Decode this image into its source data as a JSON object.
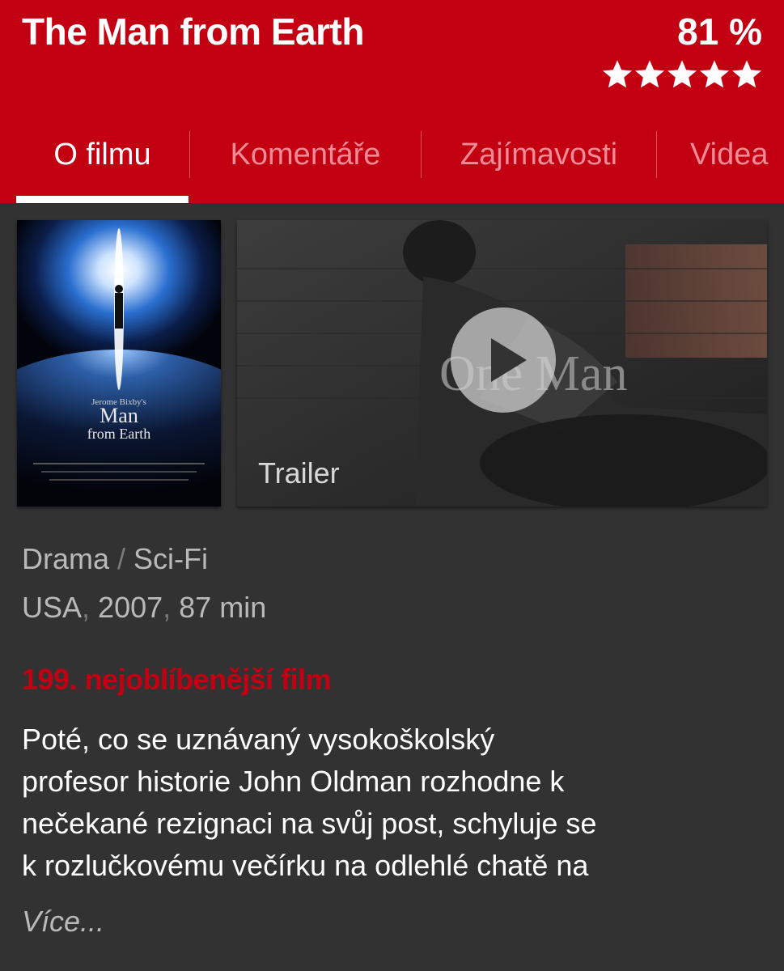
{
  "header": {
    "title": "The Man from Earth",
    "rating_percent": "81 %",
    "rating_stars": 5,
    "max_stars": 5
  },
  "tabs": [
    {
      "label": "O filmu",
      "active": true
    },
    {
      "label": "Komentáře",
      "active": false
    },
    {
      "label": "Zajímavosti",
      "active": false
    },
    {
      "label": "Videa",
      "active": false
    }
  ],
  "media": {
    "poster_icon": "movie-poster-image",
    "trailer_label": "Trailer",
    "trailer_overlay_text": "One Man",
    "play_icon": "play-icon"
  },
  "info": {
    "genres": [
      "Drama",
      "Sci-Fi"
    ],
    "genre_separator": " / ",
    "country": "USA",
    "year": "2007",
    "runtime": "87 min",
    "meta_separator": ", "
  },
  "popularity": "199. nejoblíbenější film",
  "plot_lines": [
    "Poté, co se uznávaný vysokoškolský",
    "profesor historie John Oldman rozhodne k",
    "nečekané rezignaci na svůj post, schyluje se",
    "k rozlučkovému večírku na odlehlé chatě na"
  ],
  "more_label": "Více...",
  "colors": {
    "brand_red": "#c30012",
    "background": "#323232",
    "muted_text": "#b9b9b9",
    "inactive_tab": "#f08a95"
  },
  "poster_text": {
    "title_line1": "Man",
    "title_line2": "from Earth",
    "tagline": "Jerome Bixby's"
  }
}
